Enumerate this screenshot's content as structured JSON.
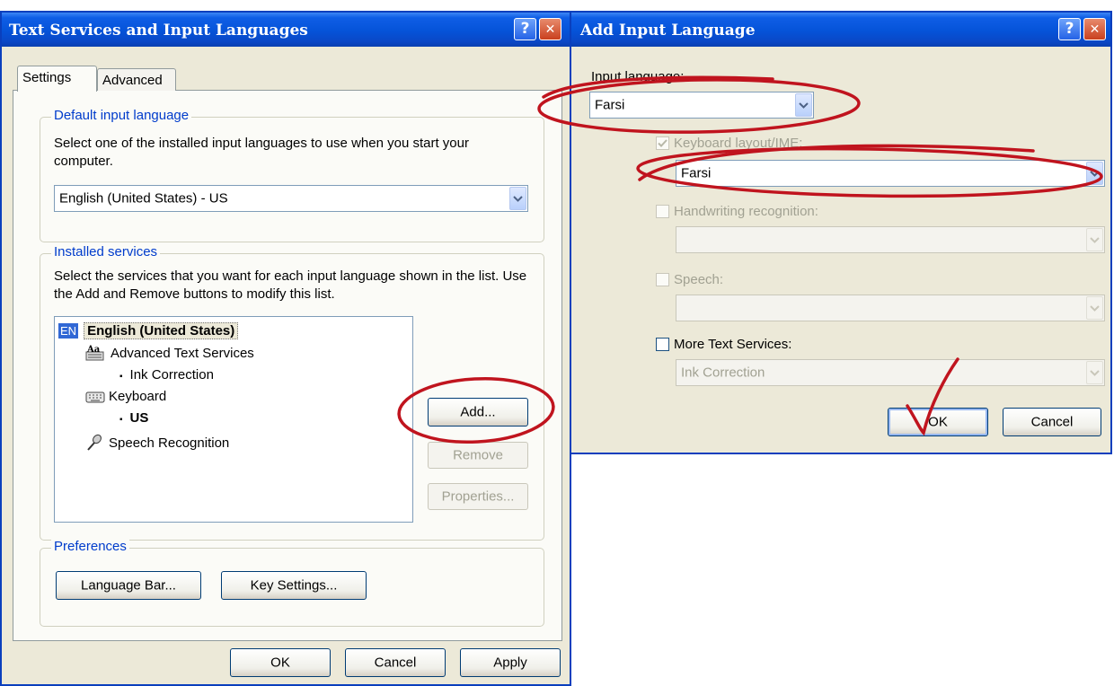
{
  "text_services_dialog": {
    "title": "Text Services and Input Languages",
    "tabs": [
      {
        "label": "Settings"
      },
      {
        "label": "Advanced"
      }
    ],
    "default_language": {
      "legend": "Default input language",
      "description": "Select one of the installed input languages to use when you start your computer.",
      "selected": "English (United States) - US"
    },
    "installed_services": {
      "legend": "Installed services",
      "description": "Select the services that you want for each input language shown in the list. Use the Add and Remove buttons to modify this list.",
      "tree": {
        "language_badge": "EN",
        "language": "English (United States)",
        "advanced_text_services": "Advanced Text Services",
        "ink_correction": "Ink Correction",
        "keyboard": "Keyboard",
        "keyboard_layout": "US",
        "speech_recognition": "Speech Recognition",
        "bullet": "▪"
      },
      "add_button": "Add...",
      "remove_button": "Remove",
      "properties_button": "Properties..."
    },
    "preferences": {
      "legend": "Preferences",
      "language_bar_button": "Language Bar...",
      "key_settings_button": "Key Settings..."
    },
    "ok_button": "OK",
    "cancel_button": "Cancel",
    "apply_button": "Apply"
  },
  "add_input_language_dialog": {
    "title": "Add Input Language",
    "input_language_label": "Input language:",
    "input_language_value": "Farsi",
    "keyboard_layout_label": "Keyboard layout/IME:",
    "keyboard_layout_value": "Farsi",
    "handwriting_label": "Handwriting recognition:",
    "speech_label": "Speech:",
    "more_text_services_label": "More Text Services:",
    "more_text_services_value": "Ink Correction",
    "ok_button": "OK",
    "cancel_button": "Cancel"
  },
  "titlebar_buttons": {
    "help": "?",
    "close": "✕"
  },
  "colors": {
    "titlebar": "#0553d8",
    "window_face": "#ece9d8",
    "legend_text": "#003ccc",
    "annotation": "#c0141e"
  }
}
